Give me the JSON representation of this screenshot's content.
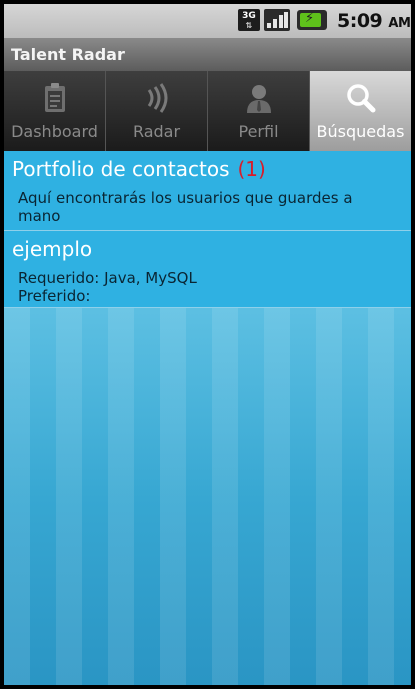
{
  "status": {
    "network": "3G",
    "time": "5:09",
    "ampm": "AM"
  },
  "app": {
    "title": "Talent Radar"
  },
  "tabs": [
    {
      "label": "Dashboard",
      "icon": "clipboard-icon",
      "active": false
    },
    {
      "label": "Radar",
      "icon": "radar-waves-icon",
      "active": false
    },
    {
      "label": "Perfil",
      "icon": "person-icon",
      "active": false
    },
    {
      "label": "Búsquedas",
      "icon": "magnifier-icon",
      "active": true
    }
  ],
  "cards": [
    {
      "title": "Portfolio de contactos",
      "count": "(1)",
      "description": "Aquí encontrarás los usuarios que guardes a mano"
    },
    {
      "title": "ejemplo",
      "required": "Requerido: Java, MySQL",
      "preferred": "Preferido:"
    }
  ],
  "colors": {
    "card_bg": "#2fb1e2",
    "count": "#d81d2a",
    "battery": "#5fc11b"
  }
}
